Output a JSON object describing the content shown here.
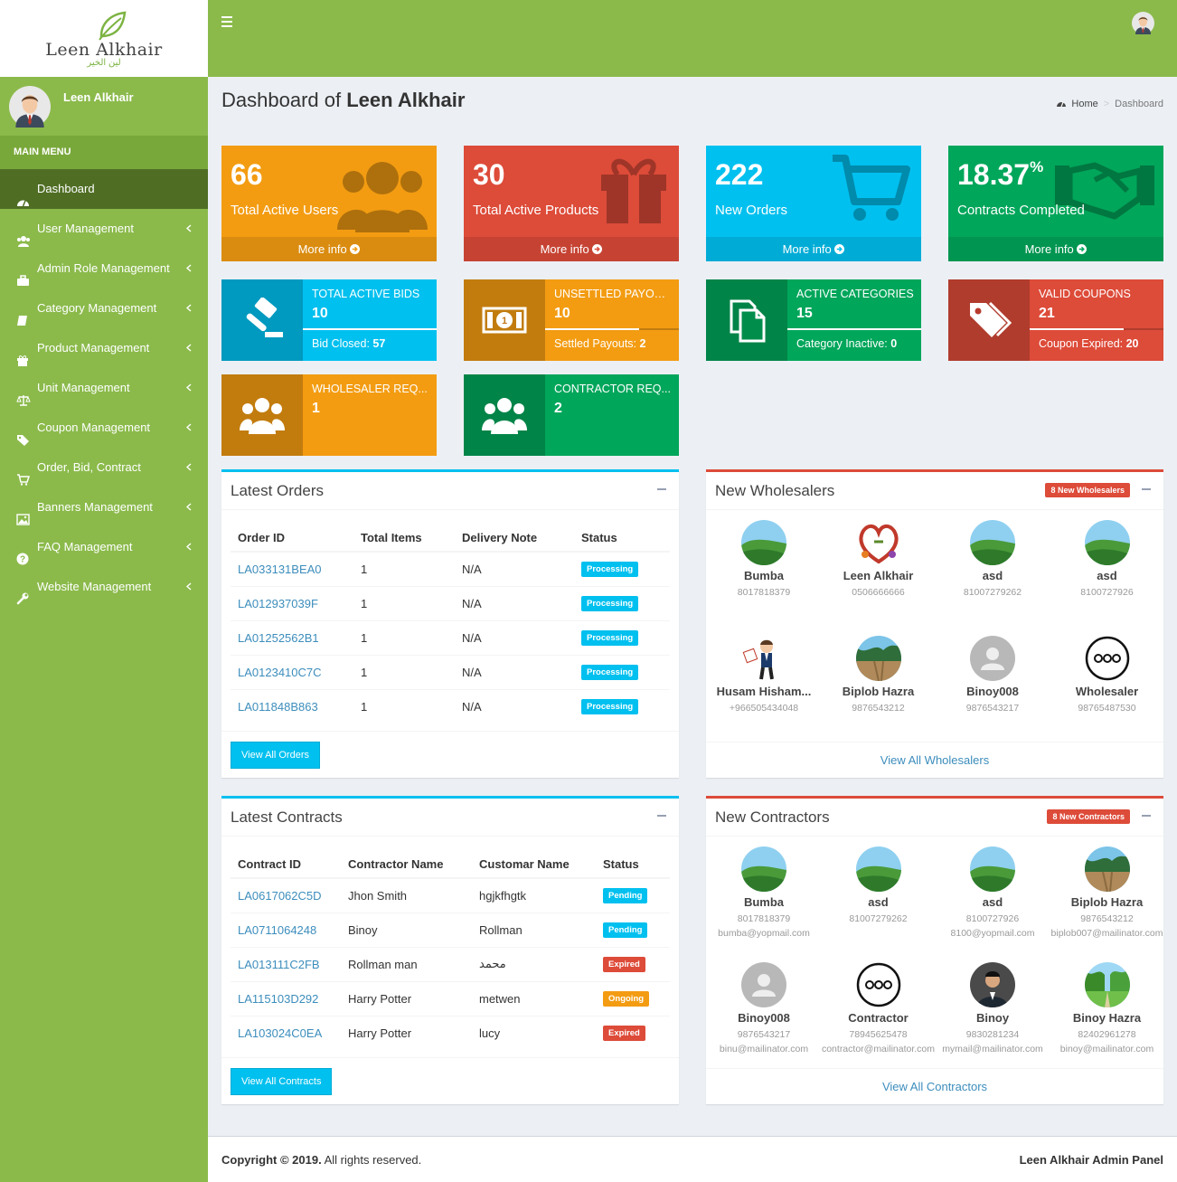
{
  "brand": {
    "name": "Leen Alkhair",
    "arabic": "لين الخير"
  },
  "sidebar": {
    "user_name": "Leen Alkhair",
    "main_menu_label": "MAIN MENU",
    "items": [
      {
        "label": "Dashboard",
        "icon": "dashboard-icon"
      },
      {
        "label": "User Management",
        "icon": "users-icon"
      },
      {
        "label": "Admin Role Management",
        "icon": "briefcase-icon"
      },
      {
        "label": "Category Management",
        "icon": "book-icon"
      },
      {
        "label": "Product Management",
        "icon": "gift-icon"
      },
      {
        "label": "Unit Management",
        "icon": "balance-scale-icon"
      },
      {
        "label": "Coupon Management",
        "icon": "tag-icon"
      },
      {
        "label": "Order, Bid, Contract",
        "icon": "cart-icon"
      },
      {
        "label": "Banners Management",
        "icon": "image-icon"
      },
      {
        "label": "FAQ Management",
        "icon": "question-circle-icon"
      },
      {
        "label": "Website Management",
        "icon": "wrench-icon"
      }
    ]
  },
  "header": {
    "title_prefix": "Dashboard of",
    "title_name": "Leen Alkhair"
  },
  "breadcrumb": {
    "home": "Home",
    "current": "Dashboard"
  },
  "stat_boxes": [
    {
      "value": "66",
      "label": "Total Active Users",
      "more": "More info",
      "color": "#f39c12"
    },
    {
      "value": "30",
      "label": "Total Active Products",
      "more": "More info",
      "color": "#dd4b39"
    },
    {
      "value": "222",
      "label": "New Orders",
      "more": "More info",
      "color": "#00c0ef"
    },
    {
      "value": "18.37",
      "suffix": "%",
      "label": "Contracts Completed",
      "more": "More info",
      "color": "#00a65a"
    }
  ],
  "info_boxes": [
    {
      "title": "TOTAL ACTIVE BIDS",
      "value": "10",
      "desc_label": "Bid Closed:",
      "desc_value": "57",
      "progress": 1.0,
      "color": "#00c0ef"
    },
    {
      "title": "UNSETTLED PAYOUTS",
      "value": "10",
      "desc_label": "Settled Payouts:",
      "desc_value": "2",
      "progress": 0.7,
      "color": "#f39c12"
    },
    {
      "title": "ACTIVE CATEGORIES",
      "value": "15",
      "desc_label": "Category Inactive:",
      "desc_value": "0",
      "progress": 1.0,
      "color": "#00a65a"
    },
    {
      "title": "VALID COUPONS",
      "value": "21",
      "desc_label": "Coupon Expired:",
      "desc_value": "20",
      "progress": 0.7,
      "color": "#dd4b39"
    },
    {
      "title": "WHOLESALER REQ...",
      "value": "1",
      "color": "#f39c12"
    },
    {
      "title": "CONTRACTOR REQ...",
      "value": "2",
      "color": "#00a65a"
    }
  ],
  "latest_orders": {
    "title": "Latest Orders",
    "columns": [
      "Order ID",
      "Total Items",
      "Delivery Note",
      "Status"
    ],
    "rows": [
      {
        "id": "LA033131BEA0",
        "items": "1",
        "note": "N/A",
        "status": "Processing"
      },
      {
        "id": "LA012937039F",
        "items": "1",
        "note": "N/A",
        "status": "Processing"
      },
      {
        "id": "LA01252562B1",
        "items": "1",
        "note": "N/A",
        "status": "Processing"
      },
      {
        "id": "LA0123410C7C",
        "items": "1",
        "note": "N/A",
        "status": "Processing"
      },
      {
        "id": "LA011848B863",
        "items": "1",
        "note": "N/A",
        "status": "Processing"
      }
    ],
    "button": "View All Orders"
  },
  "latest_contracts": {
    "title": "Latest Contracts",
    "columns": [
      "Contract ID",
      "Contractor Name",
      "Customar Name",
      "Status"
    ],
    "rows": [
      {
        "id": "LA0617062C5D",
        "contractor": "Jhon Smith",
        "customer": "hgjkfhgtk",
        "status": "Pending"
      },
      {
        "id": "LA0711064248",
        "contractor": "Binoy",
        "customer": "Rollman",
        "status": "Pending"
      },
      {
        "id": "LA013111C2FB",
        "contractor": "Rollman man",
        "customer": "محمد",
        "status": "Expired"
      },
      {
        "id": "LA115103D292",
        "contractor": "Harry Potter",
        "customer": "metwen",
        "status": "Ongoing"
      },
      {
        "id": "LA103024C0EA",
        "contractor": "Harry Potter",
        "customer": "lucy",
        "status": "Expired"
      }
    ],
    "button": "View All Contracts"
  },
  "new_wholesalers": {
    "title": "New Wholesalers",
    "badge": "8 New Wholesalers",
    "users": [
      {
        "name": "Bumba",
        "phone": "8017818379",
        "avatar": "landscape"
      },
      {
        "name": "Leen Alkhair",
        "phone": "0506666666",
        "avatar": "logo"
      },
      {
        "name": "asd",
        "phone": "81007279262",
        "avatar": "landscape"
      },
      {
        "name": "asd",
        "phone": "8100727926",
        "avatar": "landscape"
      },
      {
        "name": "Husam Hisham...",
        "phone": "+966505434048",
        "avatar": "cartoon"
      },
      {
        "name": "Biplob Hazra",
        "phone": "9876543212",
        "avatar": "lake"
      },
      {
        "name": "Binoy008",
        "phone": "9876543217",
        "avatar": "default"
      },
      {
        "name": "Wholesaler",
        "phone": "98765487530",
        "avatar": "dots"
      }
    ],
    "view_all": "View All Wholesalers"
  },
  "new_contractors": {
    "title": "New Contractors",
    "badge": "8 New Contractors",
    "users": [
      {
        "name": "Bumba",
        "phone": "8017818379",
        "email": "bumba@yopmail.com",
        "avatar": "landscape"
      },
      {
        "name": "asd",
        "phone": "81007279262",
        "email": "",
        "avatar": "landscape"
      },
      {
        "name": "asd",
        "phone": "8100727926",
        "email": "8100@yopmail.com",
        "avatar": "landscape"
      },
      {
        "name": "Biplob Hazra",
        "phone": "9876543212",
        "email": "biplob007@mailinator.com",
        "avatar": "lake"
      },
      {
        "name": "Binoy008",
        "phone": "9876543217",
        "email": "binu@mailinator.com",
        "avatar": "default"
      },
      {
        "name": "Contractor",
        "phone": "78945625478",
        "email": "contractor@mailinator.com",
        "avatar": "dots"
      },
      {
        "name": "Binoy",
        "phone": "9830281234",
        "email": "mymail@mailinator.com",
        "avatar": "person"
      },
      {
        "name": "Binoy Hazra",
        "phone": "82402961278",
        "email": "binoy@mailinator.com",
        "avatar": "park"
      }
    ],
    "view_all": "View All Contractors"
  },
  "footer": {
    "copyright": "Copyright © 2019.",
    "rights": "All rights reserved.",
    "panel": "Leen Alkhair Admin Panel"
  }
}
